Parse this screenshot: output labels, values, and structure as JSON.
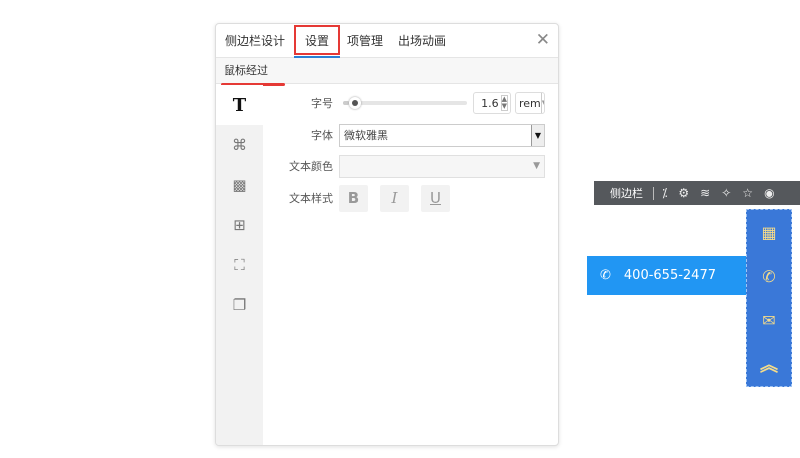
{
  "panel": {
    "tabs": [
      {
        "label": "侧边栏设计"
      },
      {
        "label": "设置"
      },
      {
        "label": "项管理"
      },
      {
        "label": "出场动画"
      }
    ],
    "close_icon": "close-icon",
    "subtab": "鼠标经过",
    "side_icons": [
      "text-icon",
      "grid-icon",
      "pattern-icon",
      "layout-icon",
      "border-icon",
      "shadow-icon"
    ],
    "side_text_glyph": "T",
    "form": {
      "font_size_label": "字号",
      "font_size_value": "1.6",
      "font_size_slider_fraction": 0.05,
      "font_size_unit": "rem",
      "font_family_label": "字体",
      "font_family_value": "微软雅黑",
      "text_color_label": "文本颜色",
      "text_style_label": "文本样式",
      "bold": "B",
      "italic": "I",
      "underline": "U"
    }
  },
  "toolbar": {
    "title": "侧边栏",
    "icons": [
      "magic-wand-icon",
      "gear-icon",
      "layers-icon",
      "sparkle-icon",
      "star-icon",
      "eye-icon"
    ]
  },
  "sidebar_widget": {
    "phone": "400-655-2477",
    "icons": [
      "qrcode-icon",
      "phone-icon",
      "mail-icon",
      "back-to-top-icon"
    ],
    "colors": {
      "column": "#3a78d8",
      "phone_bar": "#2196f3",
      "icon": "#f5dc8a"
    }
  }
}
